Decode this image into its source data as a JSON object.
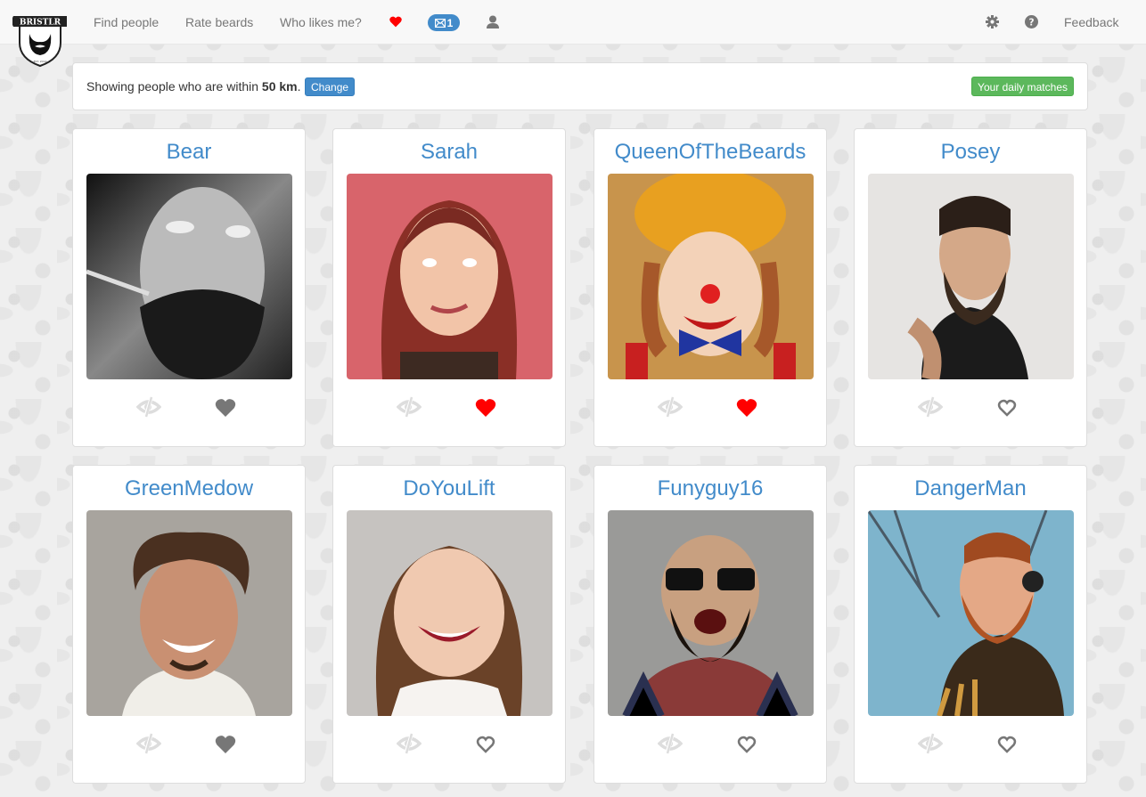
{
  "navbar": {
    "logo_text": "BRISTLR",
    "links": [
      "Find people",
      "Rate beards",
      "Who likes me?"
    ],
    "message_count": "1",
    "right": {
      "feedback": "Feedback"
    },
    "icons": [
      "heart-icon",
      "envelope-icon",
      "user-icon",
      "gear-icon",
      "question-icon"
    ],
    "accent": "#428bca",
    "heart_color": "#ff0000"
  },
  "info": {
    "prefix": "Showing people who are within ",
    "distance": "50 km",
    "suffix": ".",
    "change_label": "Change",
    "daily_matches_label": "Your daily matches"
  },
  "profiles": [
    {
      "name": "Bear",
      "like_state": "solid",
      "photo": "bw-man-mustache"
    },
    {
      "name": "Sarah",
      "like_state": "liked",
      "photo": "woman-red-hair"
    },
    {
      "name": "QueenOfTheBeards",
      "like_state": "liked",
      "photo": "clown-woman"
    },
    {
      "name": "Posey",
      "like_state": "outline",
      "photo": "bearded-man-tattoos"
    },
    {
      "name": "GreenMedow",
      "like_state": "solid",
      "photo": "curly-hair-man"
    },
    {
      "name": "DoYouLift",
      "like_state": "outline",
      "photo": "smiling-woman"
    },
    {
      "name": "Funyguy16",
      "like_state": "outline",
      "photo": "bald-bearded-sunglasses"
    },
    {
      "name": "DangerMan",
      "like_state": "outline",
      "photo": "ginger-beard-headphones"
    }
  ]
}
